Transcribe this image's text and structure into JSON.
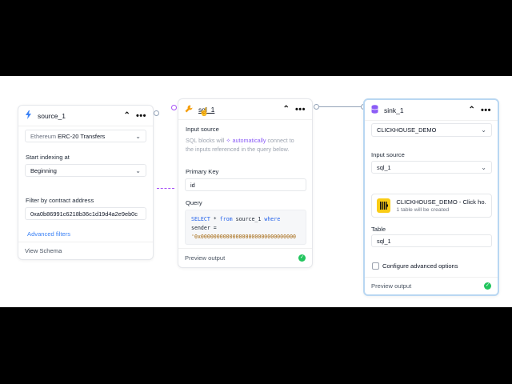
{
  "source": {
    "title": "source_1",
    "dataset_chain": "Ethereum",
    "dataset_name": "ERC-20 Transfers",
    "start_label": "Start indexing at",
    "start_value": "Beginning",
    "filter_label": "Filter by contract address",
    "filter_value": "0xa0b86991c6218b36c1d19d4a2e9eb0c",
    "advanced_label": "Advanced filters",
    "footer_label": "View Schema"
  },
  "sql": {
    "title": "sql_1",
    "input_label": "Input source",
    "hint_line1": "SQL blocks will",
    "hint_auto": "automatically",
    "hint_rest1": "connect to",
    "hint_line2": "the inputs referenced in the query below.",
    "pk_label": "Primary Key",
    "pk_value": "id",
    "query_label": "Query",
    "q_select": "SELECT",
    "q_star": " * ",
    "q_from": "from",
    "q_table": " source_1 ",
    "q_where": "where",
    "q_line2": "sender =",
    "q_line3": "'0x000000000000000000000000000000",
    "footer_label": "Preview output"
  },
  "sink": {
    "title": "sink_1",
    "db_value": "CLICKHOUSE_DEMO",
    "input_label": "Input source",
    "input_value": "sql_1",
    "card_title": "CLICKHOUSE_DEMO - Click ho...",
    "card_sub": "1 table will be created",
    "table_label": "Table",
    "table_value": "sql_1",
    "advanced_label": "Configure advanced options",
    "footer_label": "Preview output"
  },
  "colors": {
    "accent": "#2563eb",
    "advanced": "#3b82f6",
    "auto": "#8b5cf6",
    "ok": "#22c55e",
    "selected_border": "#b9d7f2",
    "clickhouse": "#facc15"
  },
  "icons": {
    "source": "bolt-icon",
    "sql": "wrench-icon",
    "sink": "database-icon",
    "collapse": "chevron-up-icon",
    "menu": "more-dots-icon",
    "dropdown": "chevron-down-icon",
    "status": "check-circle-icon",
    "cursor": "pointer-cursor-icon"
  }
}
